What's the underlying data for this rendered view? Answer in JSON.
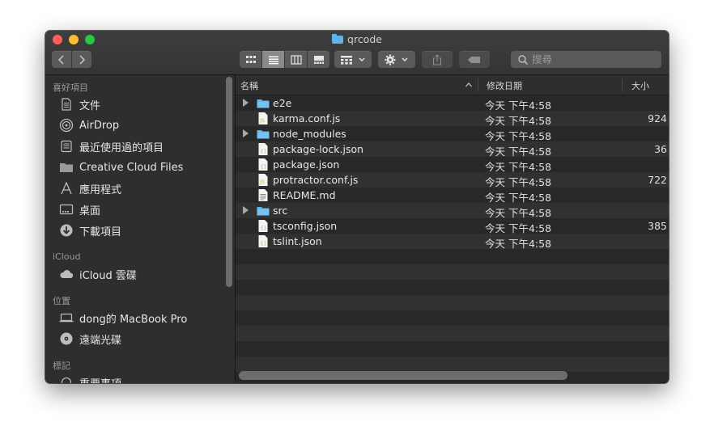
{
  "window": {
    "title": "qrcode"
  },
  "toolbar": {
    "back_icon": "chevron-left-icon",
    "forward_icon": "chevron-right-icon",
    "search_placeholder": "搜尋"
  },
  "sidebar": {
    "sections": [
      {
        "label": "喜好項目"
      },
      {
        "label": "iCloud"
      },
      {
        "label": "位置"
      },
      {
        "label": "標記"
      }
    ],
    "items": [
      {
        "label": "文件",
        "icon": "document-icon"
      },
      {
        "label": "AirDrop",
        "icon": "airdrop-icon"
      },
      {
        "label": "最近使用過的項目",
        "icon": "recents-icon"
      },
      {
        "label": "Creative Cloud Files",
        "icon": "folder-icon"
      },
      {
        "label": "應用程式",
        "icon": "applications-icon"
      },
      {
        "label": "桌面",
        "icon": "desktop-icon"
      },
      {
        "label": "下載項目",
        "icon": "downloads-icon"
      },
      {
        "label": "iCloud 雲碟",
        "icon": "cloud-icon"
      },
      {
        "label": "dong的 MacBook Pro",
        "icon": "laptop-icon"
      },
      {
        "label": "遠端光碟",
        "icon": "disc-icon"
      },
      {
        "label": "重要事項",
        "icon": "tag-icon"
      }
    ]
  },
  "list": {
    "columns": {
      "name": "名稱",
      "date": "修改日期",
      "size": "大小"
    },
    "rows": [
      {
        "name": "e2e",
        "date": "今天 下午4:58",
        "size": "",
        "kind": "folder",
        "expandable": true
      },
      {
        "name": "karma.conf.js",
        "date": "今天 下午4:58",
        "size": "924",
        "kind": "js",
        "expandable": false
      },
      {
        "name": "node_modules",
        "date": "今天 下午4:58",
        "size": "",
        "kind": "folder",
        "expandable": true
      },
      {
        "name": "package-lock.json",
        "date": "今天 下午4:58",
        "size": "36",
        "kind": "json",
        "expandable": false
      },
      {
        "name": "package.json",
        "date": "今天 下午4:58",
        "size": "",
        "kind": "json",
        "expandable": false
      },
      {
        "name": "protractor.conf.js",
        "date": "今天 下午4:58",
        "size": "722",
        "kind": "js",
        "expandable": false
      },
      {
        "name": "README.md",
        "date": "今天 下午4:58",
        "size": "",
        "kind": "text",
        "expandable": false
      },
      {
        "name": "src",
        "date": "今天 下午4:58",
        "size": "",
        "kind": "folder",
        "expandable": true
      },
      {
        "name": "tsconfig.json",
        "date": "今天 下午4:58",
        "size": "385",
        "kind": "json",
        "expandable": false
      },
      {
        "name": "tslint.json",
        "date": "今天 下午4:58",
        "size": "",
        "kind": "json",
        "expandable": false
      }
    ]
  },
  "colors": {
    "folder": "#5fb3e8",
    "js_badge": "#c9b43a",
    "close": "#ff5f57",
    "minimize": "#febc2e",
    "zoom": "#28c840"
  }
}
